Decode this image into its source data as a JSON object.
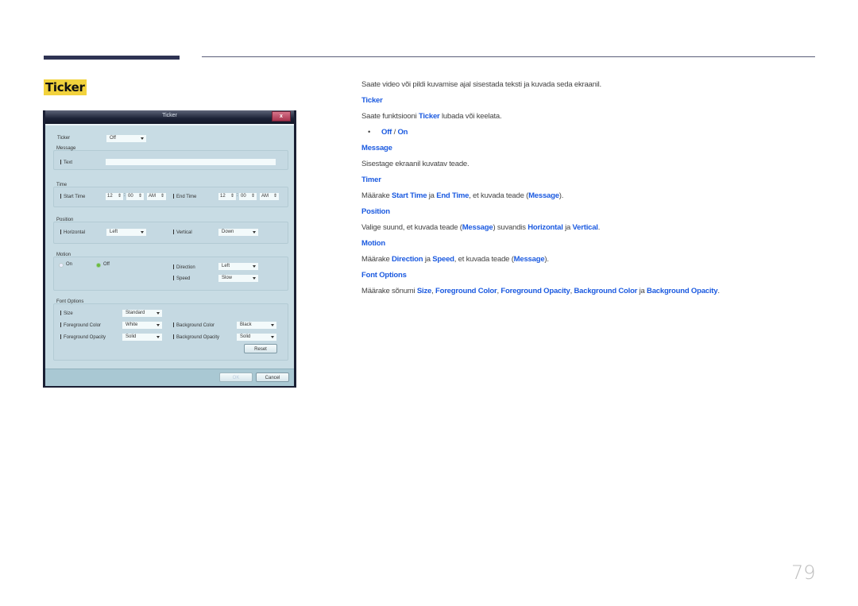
{
  "header": {
    "section_title": "Ticker"
  },
  "dialog": {
    "title": "Ticker",
    "close_label": "x",
    "ticker_label": "Ticker",
    "ticker_value": "Off",
    "message_group": "Message",
    "text_label": "Text",
    "text_value": "",
    "time_group": "Time",
    "start_time_label": "Start Time",
    "start_hour": "12",
    "start_min": "00",
    "start_ampm": "AM",
    "end_time_label": "End Time",
    "end_hour": "12",
    "end_min": "00",
    "end_ampm": "AM",
    "position_group": "Position",
    "horizontal_label": "Horizontal",
    "horizontal_value": "Left",
    "vertical_label": "Vertical",
    "vertical_value": "Down",
    "motion_group": "Motion",
    "motion_on": "On",
    "motion_off": "Off",
    "motion_selected": "Off",
    "direction_label": "Direction",
    "direction_value": "Left",
    "speed_label": "Speed",
    "speed_value": "Slow",
    "font_group": "Font Options",
    "size_label": "Size",
    "size_value": "Standard",
    "fg_color_label": "Foreground Color",
    "fg_color_value": "White",
    "bg_color_label": "Background Color",
    "bg_color_value": "Black",
    "fg_opacity_label": "Foreground Opacity",
    "fg_opacity_value": "Solid",
    "bg_opacity_label": "Background Opacity",
    "bg_opacity_value": "Solid",
    "reset_label": "Reset",
    "ok_label": "OK",
    "cancel_label": "Cancel"
  },
  "content": {
    "intro": "Saate video või pildi kuvamise ajal sisestada teksti ja kuvada seda ekraanil.",
    "ticker_heading": "Ticker",
    "ticker_desc_a": "Saate funktsiooni ",
    "ticker_desc_kw": "Ticker",
    "ticker_desc_b": " lubada või keelata.",
    "bullet": "•",
    "opt_off": "Off",
    "opt_sep": " / ",
    "opt_on": "On",
    "message_heading": "Message",
    "message_desc": "Sisestage ekraanil kuvatav teade.",
    "timer_heading": "Timer",
    "timer_a": "Määrake ",
    "timer_kw1": "Start Time",
    "timer_b": " ja ",
    "timer_kw2": "End Time",
    "timer_c": ", et kuvada teade (",
    "timer_kw3": "Message",
    "timer_d": ").",
    "position_heading": "Position",
    "position_a": "Valige suund, et kuvada teade (",
    "position_kw1": "Message",
    "position_b": ") suvandis ",
    "position_kw2": "Horizontal",
    "position_c": " ja ",
    "position_kw3": "Vertical",
    "position_d": ".",
    "motion_heading": "Motion",
    "motion_a": "Määrake ",
    "motion_kw1": "Direction",
    "motion_b": " ja ",
    "motion_kw2": "Speed",
    "motion_c": ", et kuvada teade (",
    "motion_kw3": "Message",
    "motion_d": ").",
    "font_heading": "Font Options",
    "font_a": "Määrake sõnumi ",
    "font_kw1": "Size",
    "font_s1": ", ",
    "font_kw2": "Foreground Color",
    "font_s2": ", ",
    "font_kw3": "Foreground Opacity",
    "font_s3": ", ",
    "font_kw4": "Background Color",
    "font_s4": " ja ",
    "font_kw5": "Background Opacity",
    "font_end": "."
  },
  "page_number": "79",
  "colors": {
    "accent": "#1b5ae0",
    "highlight": "#f2d23c",
    "header_bar": "#2e3353"
  }
}
